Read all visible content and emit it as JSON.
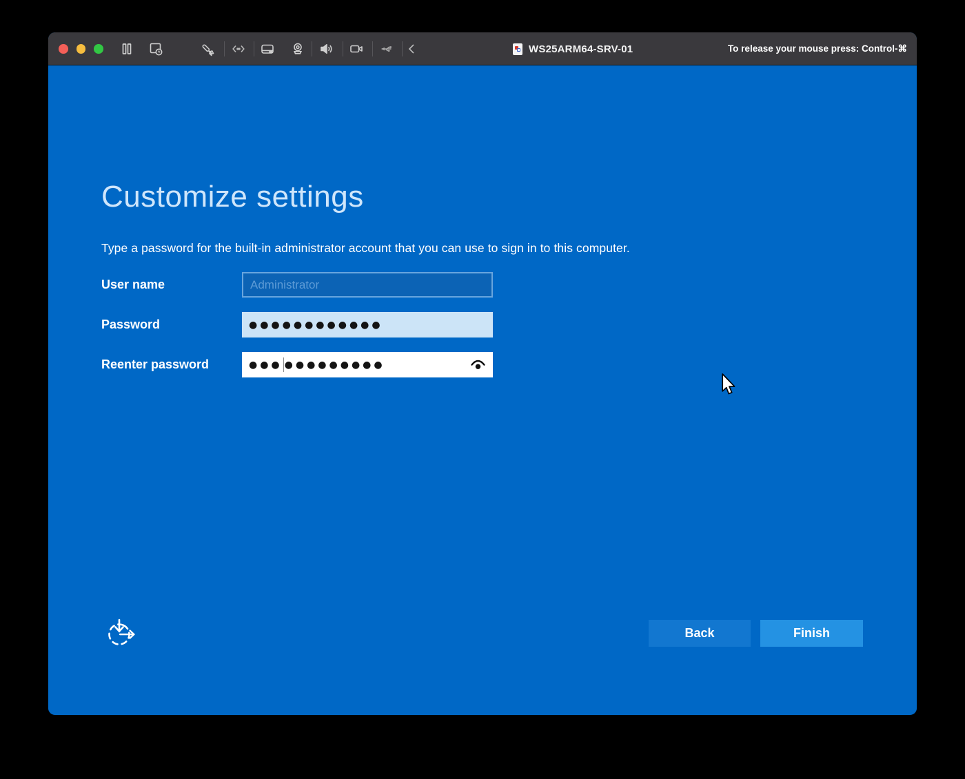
{
  "titlebar": {
    "title": "WS25ARM64-SRV-01",
    "release_hint": "To release your mouse press: Control-⌘",
    "traffic_lights": [
      "close",
      "minimize",
      "fullscreen"
    ],
    "toolbar_icons": [
      "pause",
      "snapshots",
      "settings-wrench",
      "resize-arrows",
      "hard-disk",
      "webcam",
      "sound",
      "video-camera",
      "usb",
      "collapse-chevron"
    ]
  },
  "setup": {
    "heading": "Customize settings",
    "description": "Type a password for the built-in administrator account that you can use to sign in to this computer.",
    "fields": {
      "username": {
        "label": "User name",
        "value": "",
        "placeholder": "Administrator",
        "state": "disabled"
      },
      "password": {
        "label": "Password",
        "masked_value": "●●●●●●●●●●●●",
        "dot_count": 12
      },
      "reenter": {
        "label": "Reenter password",
        "masked_before_caret": "●●●",
        "masked_after_caret": "●●●●●●●●●",
        "dot_count": 12
      }
    },
    "buttons": {
      "back": "Back",
      "finish": "Finish"
    }
  },
  "colors": {
    "screen_bg": "#0068c6",
    "titlebar_bg": "#3a393d",
    "password_field_bg": "#cce4f7",
    "reenter_field_bg": "#ffffff",
    "back_button": "#1277d0",
    "finish_button": "#2492e3",
    "heading_text": "#cfe6fb"
  }
}
